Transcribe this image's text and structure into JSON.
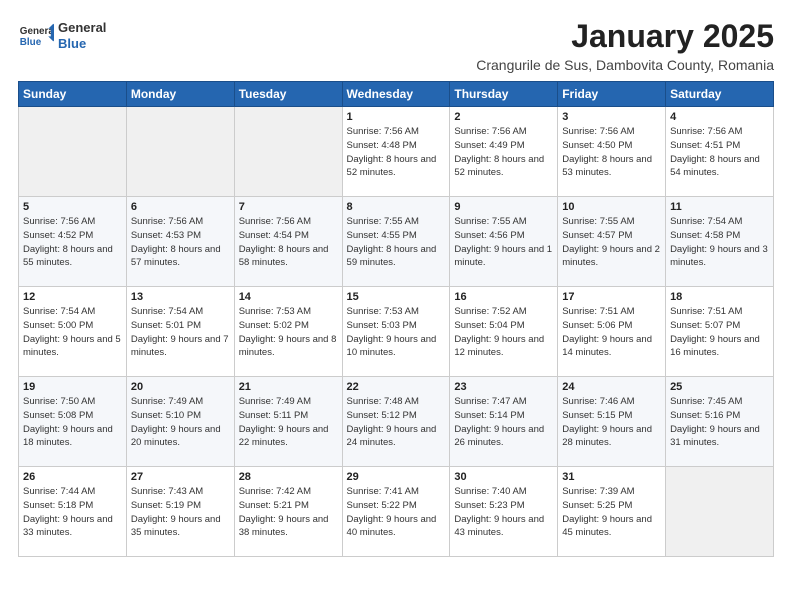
{
  "logo": {
    "general": "General",
    "blue": "Blue"
  },
  "header": {
    "title": "January 2025",
    "subtitle": "Crangurile de Sus, Dambovita County, Romania"
  },
  "weekdays": [
    "Sunday",
    "Monday",
    "Tuesday",
    "Wednesday",
    "Thursday",
    "Friday",
    "Saturday"
  ],
  "weeks": [
    [
      {
        "day": "",
        "info": ""
      },
      {
        "day": "",
        "info": ""
      },
      {
        "day": "",
        "info": ""
      },
      {
        "day": "1",
        "info": "Sunrise: 7:56 AM\nSunset: 4:48 PM\nDaylight: 8 hours and 52 minutes."
      },
      {
        "day": "2",
        "info": "Sunrise: 7:56 AM\nSunset: 4:49 PM\nDaylight: 8 hours and 52 minutes."
      },
      {
        "day": "3",
        "info": "Sunrise: 7:56 AM\nSunset: 4:50 PM\nDaylight: 8 hours and 53 minutes."
      },
      {
        "day": "4",
        "info": "Sunrise: 7:56 AM\nSunset: 4:51 PM\nDaylight: 8 hours and 54 minutes."
      }
    ],
    [
      {
        "day": "5",
        "info": "Sunrise: 7:56 AM\nSunset: 4:52 PM\nDaylight: 8 hours and 55 minutes."
      },
      {
        "day": "6",
        "info": "Sunrise: 7:56 AM\nSunset: 4:53 PM\nDaylight: 8 hours and 57 minutes."
      },
      {
        "day": "7",
        "info": "Sunrise: 7:56 AM\nSunset: 4:54 PM\nDaylight: 8 hours and 58 minutes."
      },
      {
        "day": "8",
        "info": "Sunrise: 7:55 AM\nSunset: 4:55 PM\nDaylight: 8 hours and 59 minutes."
      },
      {
        "day": "9",
        "info": "Sunrise: 7:55 AM\nSunset: 4:56 PM\nDaylight: 9 hours and 1 minute."
      },
      {
        "day": "10",
        "info": "Sunrise: 7:55 AM\nSunset: 4:57 PM\nDaylight: 9 hours and 2 minutes."
      },
      {
        "day": "11",
        "info": "Sunrise: 7:54 AM\nSunset: 4:58 PM\nDaylight: 9 hours and 3 minutes."
      }
    ],
    [
      {
        "day": "12",
        "info": "Sunrise: 7:54 AM\nSunset: 5:00 PM\nDaylight: 9 hours and 5 minutes."
      },
      {
        "day": "13",
        "info": "Sunrise: 7:54 AM\nSunset: 5:01 PM\nDaylight: 9 hours and 7 minutes."
      },
      {
        "day": "14",
        "info": "Sunrise: 7:53 AM\nSunset: 5:02 PM\nDaylight: 9 hours and 8 minutes."
      },
      {
        "day": "15",
        "info": "Sunrise: 7:53 AM\nSunset: 5:03 PM\nDaylight: 9 hours and 10 minutes."
      },
      {
        "day": "16",
        "info": "Sunrise: 7:52 AM\nSunset: 5:04 PM\nDaylight: 9 hours and 12 minutes."
      },
      {
        "day": "17",
        "info": "Sunrise: 7:51 AM\nSunset: 5:06 PM\nDaylight: 9 hours and 14 minutes."
      },
      {
        "day": "18",
        "info": "Sunrise: 7:51 AM\nSunset: 5:07 PM\nDaylight: 9 hours and 16 minutes."
      }
    ],
    [
      {
        "day": "19",
        "info": "Sunrise: 7:50 AM\nSunset: 5:08 PM\nDaylight: 9 hours and 18 minutes."
      },
      {
        "day": "20",
        "info": "Sunrise: 7:49 AM\nSunset: 5:10 PM\nDaylight: 9 hours and 20 minutes."
      },
      {
        "day": "21",
        "info": "Sunrise: 7:49 AM\nSunset: 5:11 PM\nDaylight: 9 hours and 22 minutes."
      },
      {
        "day": "22",
        "info": "Sunrise: 7:48 AM\nSunset: 5:12 PM\nDaylight: 9 hours and 24 minutes."
      },
      {
        "day": "23",
        "info": "Sunrise: 7:47 AM\nSunset: 5:14 PM\nDaylight: 9 hours and 26 minutes."
      },
      {
        "day": "24",
        "info": "Sunrise: 7:46 AM\nSunset: 5:15 PM\nDaylight: 9 hours and 28 minutes."
      },
      {
        "day": "25",
        "info": "Sunrise: 7:45 AM\nSunset: 5:16 PM\nDaylight: 9 hours and 31 minutes."
      }
    ],
    [
      {
        "day": "26",
        "info": "Sunrise: 7:44 AM\nSunset: 5:18 PM\nDaylight: 9 hours and 33 minutes."
      },
      {
        "day": "27",
        "info": "Sunrise: 7:43 AM\nSunset: 5:19 PM\nDaylight: 9 hours and 35 minutes."
      },
      {
        "day": "28",
        "info": "Sunrise: 7:42 AM\nSunset: 5:21 PM\nDaylight: 9 hours and 38 minutes."
      },
      {
        "day": "29",
        "info": "Sunrise: 7:41 AM\nSunset: 5:22 PM\nDaylight: 9 hours and 40 minutes."
      },
      {
        "day": "30",
        "info": "Sunrise: 7:40 AM\nSunset: 5:23 PM\nDaylight: 9 hours and 43 minutes."
      },
      {
        "day": "31",
        "info": "Sunrise: 7:39 AM\nSunset: 5:25 PM\nDaylight: 9 hours and 45 minutes."
      },
      {
        "day": "",
        "info": ""
      }
    ]
  ]
}
